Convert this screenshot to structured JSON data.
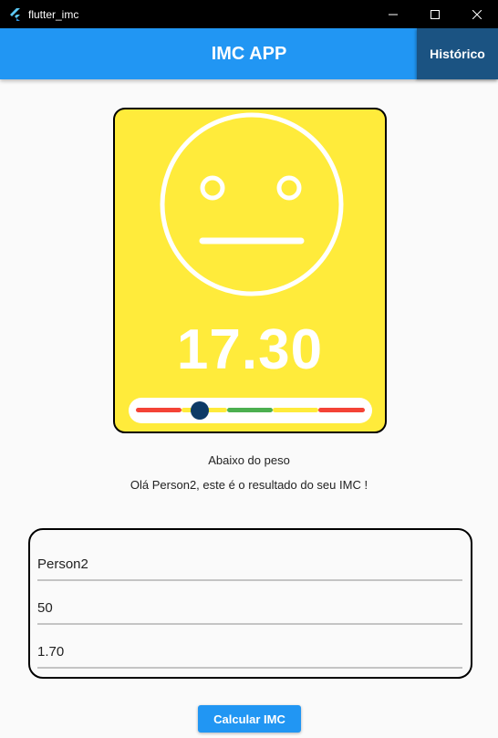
{
  "window": {
    "title": "flutter_imc",
    "min_icon": "minimize-icon",
    "max_icon": "maximize-icon",
    "close_icon": "close-icon"
  },
  "appbar": {
    "title": "IMC APP",
    "history_label": "Histórico"
  },
  "result": {
    "imc_value": "17.30",
    "status_label": "Abaixo do peso",
    "message": "Olá Person2, este é o resultado do seu IMC !",
    "face_icon": "neutral-face-icon",
    "card_color": "#ffeb3b",
    "gauge_position_fraction": 0.28,
    "gauge_colors": [
      "#f44336",
      "#ffeb3b",
      "#4caf50",
      "#ffeb3b",
      "#f44336"
    ]
  },
  "form": {
    "name_value": "Person2",
    "weight_value": "50",
    "height_value": "1.70"
  },
  "actions": {
    "calculate_label": "Calcular IMC"
  },
  "colors": {
    "primary": "#2196f3",
    "history_button": "#1b5382",
    "thumb": "#0d3a66"
  }
}
